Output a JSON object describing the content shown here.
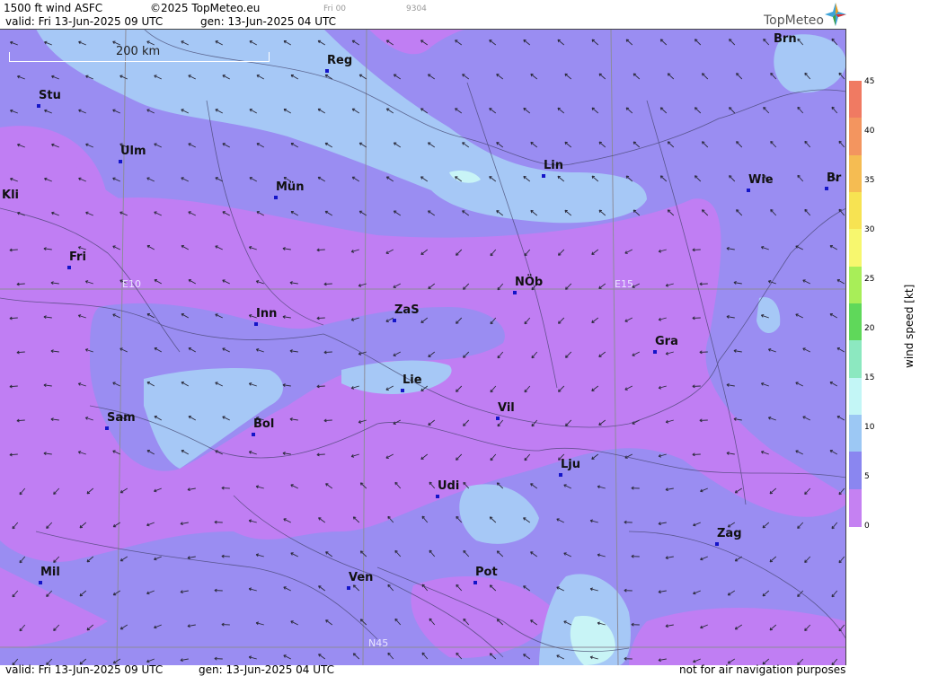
{
  "header": {
    "product": "1500 ft wind ASFC",
    "copyright": "©2025 TopMeteo.eu",
    "run_code": "Fri 00",
    "img_code": "9304",
    "valid": "valid:  Fri  13-Jun-2025  09 UTC",
    "generated": "gen: 13-Jun-2025 04 UTC"
  },
  "logo": {
    "text": "TopMeteo",
    "icon": "compass-star-icon"
  },
  "scale_bar": {
    "label": "200 km"
  },
  "grid_labels": {
    "e10": "E10",
    "e15": "E15",
    "n45": "N45"
  },
  "cities": [
    {
      "name": "Brn"
    },
    {
      "name": "Reg"
    },
    {
      "name": "Stu"
    },
    {
      "name": "Ulm"
    },
    {
      "name": "Lin"
    },
    {
      "name": "Kli"
    },
    {
      "name": "Mün"
    },
    {
      "name": "Wie"
    },
    {
      "name": "Br"
    },
    {
      "name": "Fri"
    },
    {
      "name": "NÖb"
    },
    {
      "name": "Inn"
    },
    {
      "name": "ZaS"
    },
    {
      "name": "Gra"
    },
    {
      "name": "Lie"
    },
    {
      "name": "Vil"
    },
    {
      "name": "Sam"
    },
    {
      "name": "Bol"
    },
    {
      "name": "Lju"
    },
    {
      "name": "Udi"
    },
    {
      "name": "Zag"
    },
    {
      "name": "Mil"
    },
    {
      "name": "Ven"
    },
    {
      "name": "Pot"
    }
  ],
  "legend": {
    "title": "wind  speed  [kt]",
    "ticks": [
      "45",
      "40",
      "35",
      "30",
      "25",
      "20",
      "15",
      "10",
      "5",
      "0"
    ],
    "colors": [
      "#f07a62",
      "#f3955f",
      "#f5bc52",
      "#f7e352",
      "#f7f76e",
      "#a8ee58",
      "#5fd85a",
      "#8ce8c0",
      "#c3f6f6",
      "#9cc8f4",
      "#8a86f0",
      "#c581f2"
    ]
  },
  "footer": {
    "valid": "valid:  Fri  13-Jun-2025  09 UTC",
    "generated": "gen: 13-Jun-2025 04 UTC",
    "disclaimer": "not for air navigation purposes"
  }
}
